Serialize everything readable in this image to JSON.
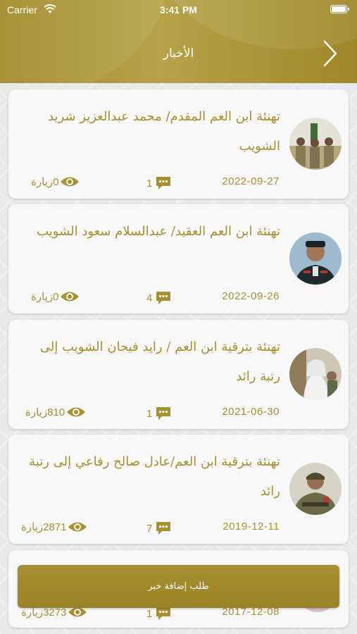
{
  "status": {
    "carrier": "Carrier",
    "time": "3:41 PM"
  },
  "nav": {
    "title": "الأخبار",
    "back_icon": "chevron-right-icon"
  },
  "news": [
    {
      "title": "تهنئة ابن العم المقدم/ محمد عبدالعزيز شريد الشويب",
      "date": "2022-09-27",
      "comments": "1",
      "views": "0",
      "views_unit": "زيارة"
    },
    {
      "title": "تهنئة ابن العم العقيد/ عبدالسلام سعود الشويب",
      "date": "2022-09-26",
      "comments": "4",
      "views": "0",
      "views_unit": "زيارة"
    },
    {
      "title": "تهنئة بترقية ابن العم / رايد فيحان الشويب إلى رتبة رائد",
      "date": "2021-06-30",
      "comments": "1",
      "views": "810",
      "views_unit": "زيارة"
    },
    {
      "title": "تهنئة بترقية ابن العم/عادل صالح رفاعي إلى رتبة رائد",
      "date": "2019-12-11",
      "comments": "7",
      "views": "2871",
      "views_unit": "زيارة"
    },
    {
      "title": "",
      "date": "2017-12-08",
      "comments": "1",
      "views": "3273",
      "views_unit": "زيارة"
    }
  ],
  "add_button": {
    "label": "طلب إضافة خبر"
  },
  "colors": {
    "accent": "#a8902e",
    "header": "#b09a3e",
    "card": "#f8f8f8"
  }
}
